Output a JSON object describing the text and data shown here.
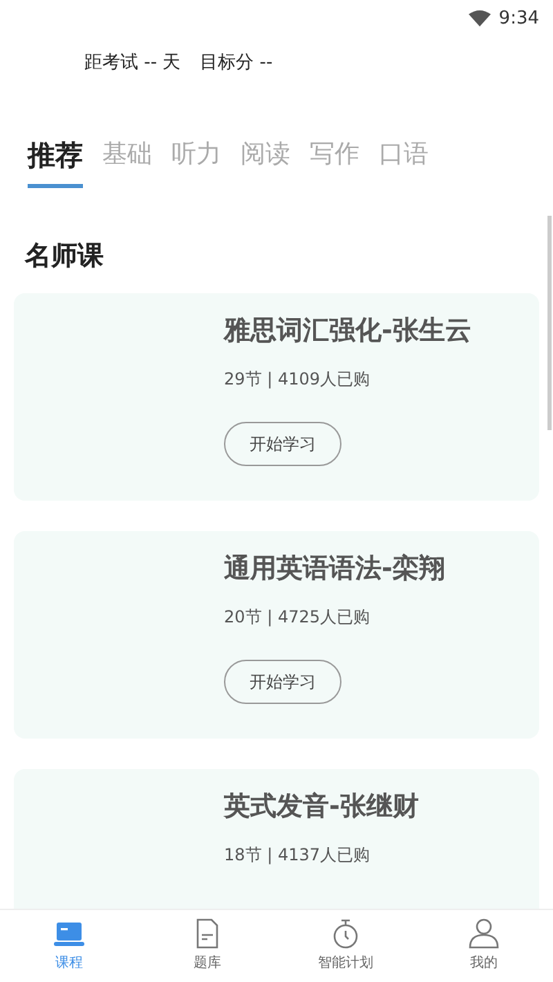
{
  "status_bar": {
    "time": "9:34"
  },
  "header": {
    "exam_countdown": "距考试 -- 天",
    "target_score": "目标分 --"
  },
  "tabs": [
    {
      "label": "推荐",
      "selected": true
    },
    {
      "label": "基础",
      "selected": false
    },
    {
      "label": "听力",
      "selected": false
    },
    {
      "label": "阅读",
      "selected": false
    },
    {
      "label": "写作",
      "selected": false
    },
    {
      "label": "口语",
      "selected": false
    }
  ],
  "section_title": "名师课",
  "courses": [
    {
      "title": "雅思词汇强化-张生云",
      "meta": "29节 | 4109人已购",
      "button": "开始学习"
    },
    {
      "title": "通用英语语法-栾翔",
      "meta": "20节 | 4725人已购",
      "button": "开始学习"
    },
    {
      "title": "英式发音-张继财",
      "meta": "18节 | 4137人已购"
    }
  ],
  "bottom_nav": [
    {
      "label": "课程",
      "selected": true
    },
    {
      "label": "题库",
      "selected": false
    },
    {
      "label": "智能计划",
      "selected": false
    },
    {
      "label": "我的",
      "selected": false
    }
  ]
}
